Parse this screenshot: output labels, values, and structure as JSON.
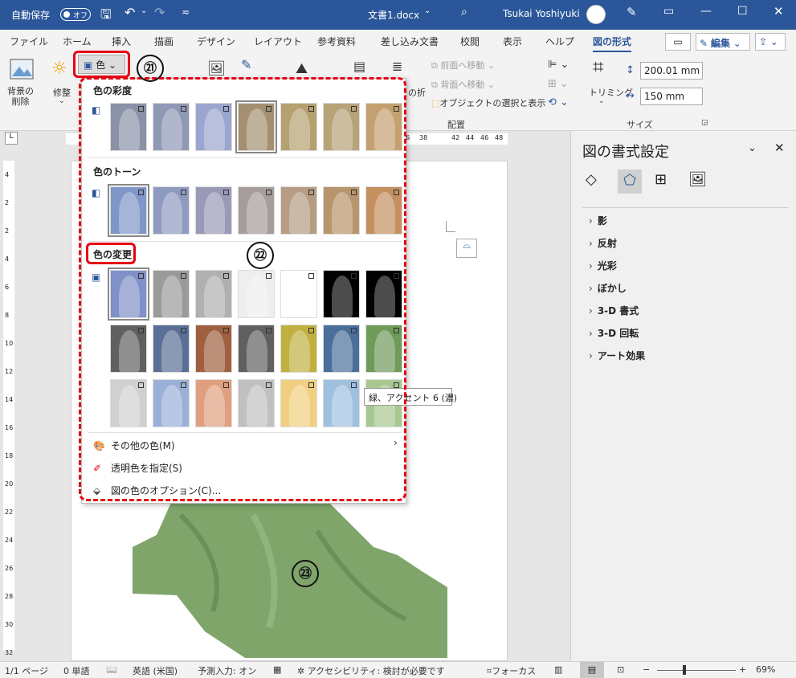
{
  "titlebar": {
    "autosave_label": "自動保存",
    "autosave_state": "オフ",
    "doc_title": "文書1.docx",
    "user_name": "Tsukai Yoshiyuki"
  },
  "tabs": [
    "ファイル",
    "ホーム",
    "挿入",
    "描画",
    "デザイン",
    "レイアウト",
    "参考資料",
    "差し込み文書",
    "校閲",
    "表示",
    "ヘルプ",
    "図の形式"
  ],
  "ribbon_right": {
    "comment_label": "",
    "edit_label": "編集",
    "share_label": ""
  },
  "ribbon": {
    "remove_bg": "背景の\n削除",
    "corrections": "修整",
    "color_button": "色",
    "text_wrap_partial": "の折",
    "bring_forward": "前面へ移動",
    "send_backward": "背面へ移動",
    "selection_pane": "オブジェクトの選択と表示",
    "arrange_group": "配置",
    "crop": "トリミング",
    "height_value": "200.01 mm",
    "width_value": "150 mm",
    "size_group": "サイズ"
  },
  "ruler_numbers": [
    "36",
    "38",
    "42",
    "44",
    "46",
    "48"
  ],
  "vruler_numbers": [
    "4",
    "2",
    "2",
    "4",
    "6",
    "8",
    "10",
    "12",
    "14",
    "16",
    "18",
    "20",
    "22",
    "24",
    "26",
    "28",
    "30",
    "32"
  ],
  "dropdown": {
    "saturation_title": "色の彩度",
    "tone_title": "色のトーン",
    "recolor_title": "色の変更",
    "more_colors": "その他の色(M)",
    "set_transparent": "透明色を指定(S)",
    "color_options": "図の色のオプション(C)..."
  },
  "tooltip": "緑、アクセント 6 (濃)",
  "annotations": {
    "n21": "㉑",
    "n22": "㉒",
    "n23": "㉓"
  },
  "pane": {
    "title": "図の書式設定",
    "items": [
      "影",
      "反射",
      "光彩",
      "ぼかし",
      "3-D 書式",
      "3-D 回転",
      "アート効果"
    ]
  },
  "status": {
    "page": "1/1 ページ",
    "words": "0 単語",
    "lang": "英語 (米国)",
    "predict": "予測入力: オン",
    "access": "アクセシビリティ: 検討が必要です",
    "focus": "フォーカス",
    "zoom": "69%"
  },
  "colors": {
    "word_blue": "#2b579a",
    "annotation_red": "#e60012",
    "recolor_green": "#7fa56b"
  }
}
